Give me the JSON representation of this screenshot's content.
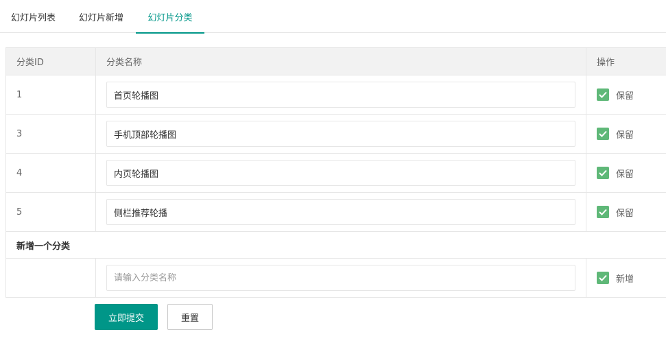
{
  "tabs": [
    {
      "label": "幻灯片列表",
      "active": false
    },
    {
      "label": "幻灯片新增",
      "active": false
    },
    {
      "label": "幻灯片分类",
      "active": true
    }
  ],
  "colors": {
    "accent": "#009688",
    "checkbox": "#5FB878"
  },
  "table": {
    "headers": {
      "id": "分类ID",
      "name": "分类名称",
      "op": "操作"
    },
    "rows": [
      {
        "id": "1",
        "name": "首页轮播图",
        "op_label": "保留",
        "checked": true
      },
      {
        "id": "3",
        "name": "手机顶部轮播图",
        "op_label": "保留",
        "checked": true
      },
      {
        "id": "4",
        "name": "内页轮播图",
        "op_label": "保留",
        "checked": true
      },
      {
        "id": "5",
        "name": "侧栏推荐轮播",
        "op_label": "保留",
        "checked": true
      }
    ],
    "new_section_title": "新增一个分类",
    "new_row": {
      "id": "",
      "placeholder": "请输入分类名称",
      "op_label": "新增",
      "checked": true
    }
  },
  "buttons": {
    "submit": "立即提交",
    "reset": "重置"
  },
  "icons": {
    "checkbox": "checkmark-icon"
  }
}
